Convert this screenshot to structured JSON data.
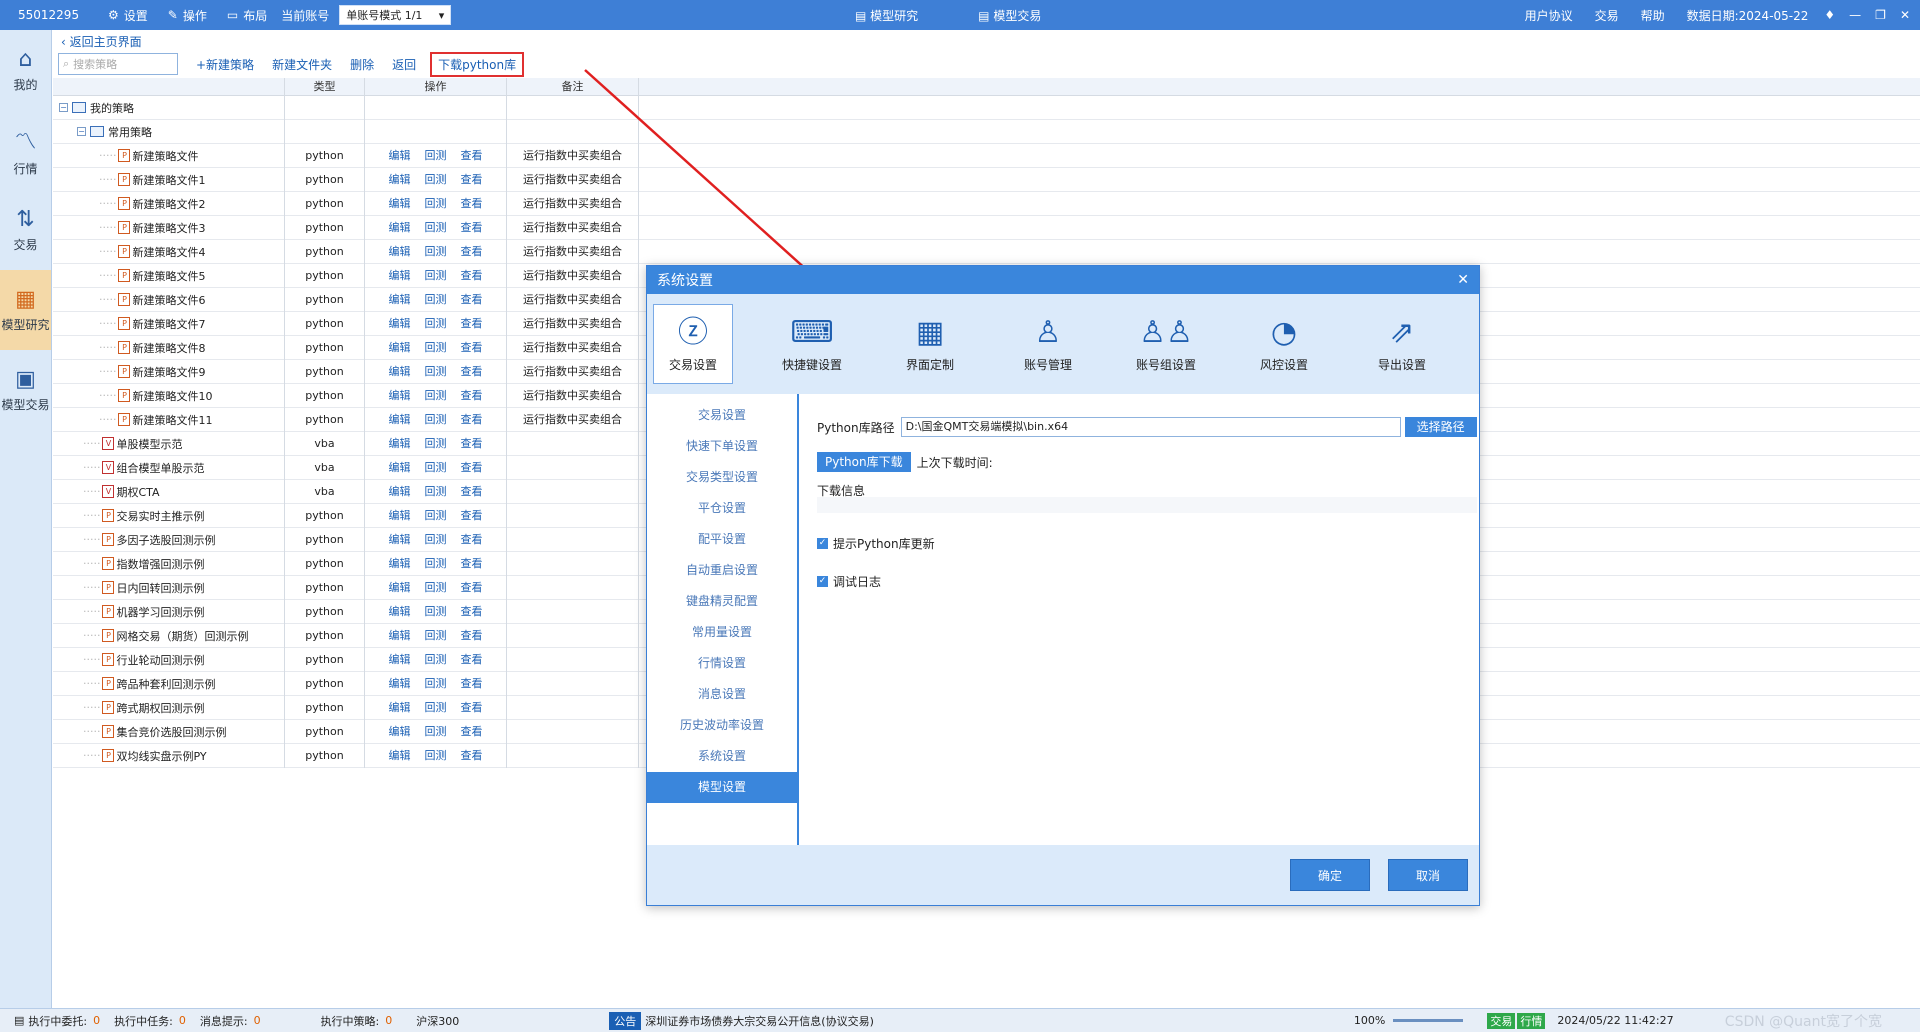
{
  "titlebar": {
    "account": "55012295",
    "settings": "设置",
    "operate": "操作",
    "layout": "布局",
    "current_account_label": "当前账号",
    "mode": "单账号模式 1/1",
    "center_tabs": [
      "模型研究",
      "模型交易"
    ],
    "right": {
      "agreement": "用户协议",
      "trade": "交易",
      "help": "帮助",
      "data_date": "数据日期:2024-05-22"
    }
  },
  "leftnav": [
    {
      "label": "我的",
      "icon": "home-icon"
    },
    {
      "label": "行情",
      "icon": "chart-icon"
    },
    {
      "label": "交易",
      "icon": "trade-icon"
    },
    {
      "label": "模型研究",
      "icon": "research-icon"
    },
    {
      "label": "模型交易",
      "icon": "model-trade-icon"
    }
  ],
  "main": {
    "back": "返回主页界面",
    "search_placeholder": "搜索策略",
    "toolbar": [
      "+新建策略",
      "新建文件夹",
      "删除",
      "返回",
      "下载python库"
    ],
    "columns": [
      "类型",
      "操作",
      "备注"
    ],
    "ops": [
      "编辑",
      "回测",
      "查看"
    ],
    "tree_root": "我的策略",
    "tree_folder": "常用策略",
    "rows": [
      {
        "name": "新建策略文件",
        "type": "python",
        "note": "运行指数中买卖组合",
        "level": 3,
        "kind": "py"
      },
      {
        "name": "新建策略文件1",
        "type": "python",
        "note": "运行指数中买卖组合",
        "level": 3,
        "kind": "py"
      },
      {
        "name": "新建策略文件2",
        "type": "python",
        "note": "运行指数中买卖组合",
        "level": 3,
        "kind": "py"
      },
      {
        "name": "新建策略文件3",
        "type": "python",
        "note": "运行指数中买卖组合",
        "level": 3,
        "kind": "py"
      },
      {
        "name": "新建策略文件4",
        "type": "python",
        "note": "运行指数中买卖组合",
        "level": 3,
        "kind": "py"
      },
      {
        "name": "新建策略文件5",
        "type": "python",
        "note": "运行指数中买卖组合",
        "level": 3,
        "kind": "py"
      },
      {
        "name": "新建策略文件6",
        "type": "python",
        "note": "运行指数中买卖组合",
        "level": 3,
        "kind": "py"
      },
      {
        "name": "新建策略文件7",
        "type": "python",
        "note": "运行指数中买卖组合",
        "level": 3,
        "kind": "py"
      },
      {
        "name": "新建策略文件8",
        "type": "python",
        "note": "运行指数中买卖组合",
        "level": 3,
        "kind": "py"
      },
      {
        "name": "新建策略文件9",
        "type": "python",
        "note": "运行指数中买卖组合",
        "level": 3,
        "kind": "py"
      },
      {
        "name": "新建策略文件10",
        "type": "python",
        "note": "运行指数中买卖组合",
        "level": 3,
        "kind": "py"
      },
      {
        "name": "新建策略文件11",
        "type": "python",
        "note": "运行指数中买卖组合",
        "level": 3,
        "kind": "py"
      },
      {
        "name": "单股模型示范",
        "type": "vba",
        "note": "",
        "level": 2,
        "kind": "vba"
      },
      {
        "name": "组合模型单股示范",
        "type": "vba",
        "note": "",
        "level": 2,
        "kind": "vba"
      },
      {
        "name": "期权CTA",
        "type": "vba",
        "note": "",
        "level": 2,
        "kind": "vba"
      },
      {
        "name": "交易实时主推示例",
        "type": "python",
        "note": "",
        "level": 2,
        "kind": "py"
      },
      {
        "name": "多因子选股回测示例",
        "type": "python",
        "note": "",
        "level": 2,
        "kind": "py"
      },
      {
        "name": "指数增强回测示例",
        "type": "python",
        "note": "",
        "level": 2,
        "kind": "py"
      },
      {
        "name": "日内回转回测示例",
        "type": "python",
        "note": "",
        "level": 2,
        "kind": "py"
      },
      {
        "name": "机器学习回测示例",
        "type": "python",
        "note": "",
        "level": 2,
        "kind": "py"
      },
      {
        "name": "网格交易（期货）回测示例",
        "type": "python",
        "note": "",
        "level": 2,
        "kind": "py"
      },
      {
        "name": "行业轮动回测示例",
        "type": "python",
        "note": "",
        "level": 2,
        "kind": "py"
      },
      {
        "name": "跨品种套利回测示例",
        "type": "python",
        "note": "",
        "level": 2,
        "kind": "py"
      },
      {
        "name": "跨式期权回测示例",
        "type": "python",
        "note": "",
        "level": 2,
        "kind": "py"
      },
      {
        "name": "集合竞价选股回测示例",
        "type": "python",
        "note": "",
        "level": 2,
        "kind": "py"
      },
      {
        "name": "双均线实盘示例PY",
        "type": "python",
        "note": "",
        "level": 2,
        "kind": "py"
      }
    ]
  },
  "dialog": {
    "title": "系统设置",
    "tabs": [
      {
        "label": "交易设置",
        "icon": "trade-settings-icon"
      },
      {
        "label": "快捷键设置",
        "icon": "keyboard-icon"
      },
      {
        "label": "界面定制",
        "icon": "layout-icon"
      },
      {
        "label": "账号管理",
        "icon": "user-icon"
      },
      {
        "label": "账号组设置",
        "icon": "users-icon"
      },
      {
        "label": "风控设置",
        "icon": "gauge-icon"
      },
      {
        "label": "导出设置",
        "icon": "export-icon"
      }
    ],
    "menu": [
      "交易设置",
      "快速下单设置",
      "交易类型设置",
      "平仓设置",
      "配平设置",
      "自动重启设置",
      "键盘精灵配置",
      "常用量设置",
      "行情设置",
      "消息设置",
      "历史波动率设置",
      "系统设置",
      "模型设置"
    ],
    "active_menu": "模型设置",
    "path_label": "Python库路径",
    "path_value": "D:\\国金QMT交易端模拟\\bin.x64",
    "choose_path": "选择路径",
    "download_btn": "Python库下载",
    "last_download": "上次下载时间:",
    "download_info": "下载信息",
    "chk_update": "提示Python库更新",
    "chk_log": "调试日志",
    "ok": "确定",
    "cancel": "取消"
  },
  "status": {
    "exec_entrust": "执行中委托:",
    "exec_entrust_n": "0",
    "exec_task": "执行中任务:",
    "exec_task_n": "0",
    "msg": "消息提示:",
    "msg_n": "0",
    "exec_strategy": "执行中策略:",
    "exec_strategy_n": "0",
    "index": "沪深300",
    "notice_tag": "公告",
    "notice": "深圳证券市场债券大宗交易公开信息(协议交易)",
    "zoom": "100%",
    "time": "2024/05/22 11:42:27",
    "trade_tag": "交易",
    "quote_tag": "行情",
    "watermark": "CSDN @Quant宽了个宽"
  }
}
